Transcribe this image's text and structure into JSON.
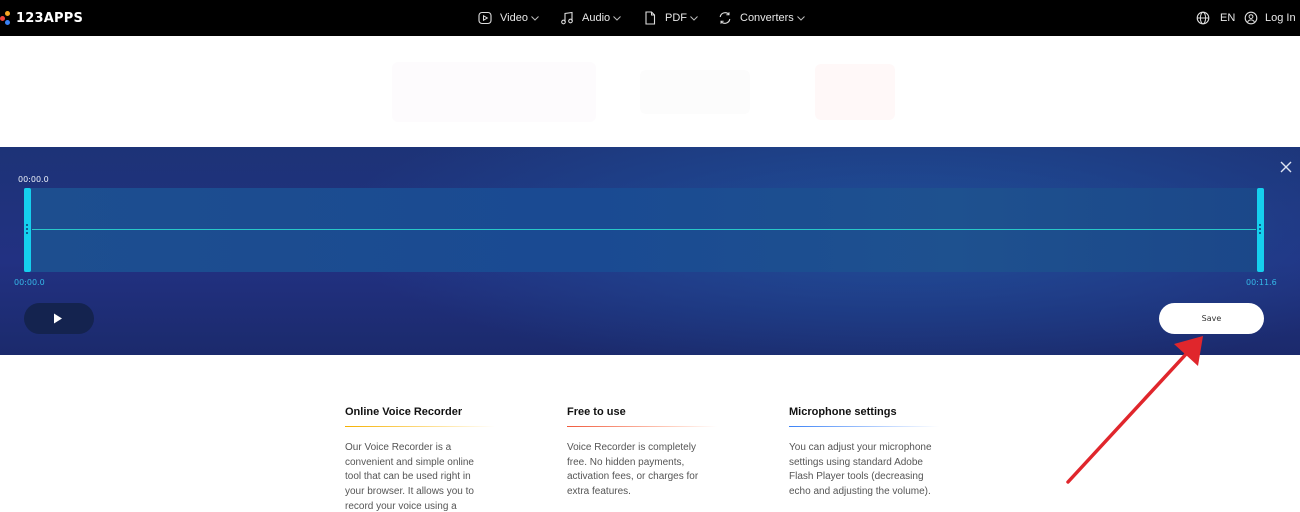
{
  "header": {
    "logo_text": "123APPS",
    "nav": [
      {
        "label": "Video",
        "icon": "video-icon"
      },
      {
        "label": "Audio",
        "icon": "music-note-icon"
      },
      {
        "label": "PDF",
        "icon": "document-icon"
      },
      {
        "label": "Converters",
        "icon": "convert-icon"
      }
    ],
    "language": "EN",
    "login": "Log In"
  },
  "editor": {
    "current_time": "00:00.0",
    "range_start": "00:00.0",
    "range_end": "00:11.6",
    "save_label": "Save"
  },
  "info": [
    {
      "title": "Online Voice Recorder",
      "lines": [
        "Our Voice Recorder is a",
        "convenient and simple online",
        "tool that can be used right in",
        "your browser. It allows you to",
        "record your voice using a"
      ]
    },
    {
      "title": "Free to use",
      "lines": [
        "Voice Recorder is completely",
        "free. No hidden payments,",
        "activation fees, or charges for",
        "extra features."
      ]
    },
    {
      "title": "Microphone settings",
      "lines": [
        "You can adjust your microphone",
        "settings using standard Adobe",
        "Flash Player tools (decreasing",
        "echo and adjusting the volume)."
      ]
    }
  ],
  "colors": {
    "topbar": "#000000",
    "editor_bg": "#1f327a",
    "waveform_handle": "#15d0ee",
    "waveform_line": "#28c8c8",
    "time_label_accent": "#34b7e6",
    "arrow": "#e0262c",
    "logo_dots": [
      "#f0463c",
      "#f5a623",
      "#3b82f6"
    ],
    "rule_gradients": [
      [
        "#f5b000",
        "#ffe9b0"
      ],
      [
        "#f05a3c",
        "#ffd0c0"
      ],
      [
        "#3b82f6",
        "#c8dcff"
      ]
    ]
  }
}
